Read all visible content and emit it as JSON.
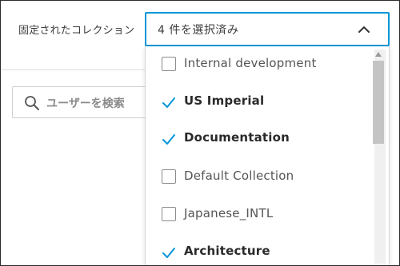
{
  "filter": {
    "label": "固定されたコレクション",
    "selected_summary": "4 件を選択済み"
  },
  "search": {
    "placeholder": "ユーザーを検索"
  },
  "options": [
    {
      "label": "Internal development",
      "checked": false
    },
    {
      "label": "US Imperial",
      "checked": true
    },
    {
      "label": "Documentation",
      "checked": true
    },
    {
      "label": "Default Collection",
      "checked": false
    },
    {
      "label": "Japanese_INTL",
      "checked": false
    },
    {
      "label": "Architecture",
      "checked": true
    }
  ],
  "colors": {
    "accent": "#0696d7",
    "border": "#cfcfcf"
  },
  "icons": {
    "chevron": "chevron-up-icon",
    "search": "search-icon",
    "check": "check-icon"
  }
}
